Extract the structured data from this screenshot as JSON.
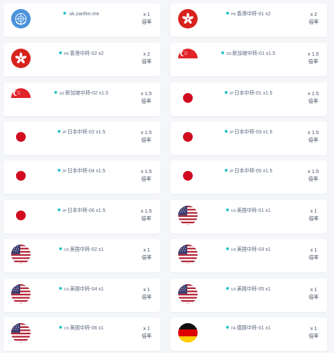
{
  "unit_label": "倍率",
  "nodes": [
    {
      "flag": "un",
      "prefix": "",
      "name": "uk.sanfen.me",
      "multiplier": "x 1"
    },
    {
      "flag": "hk",
      "prefix": "HK",
      "name": "香港中转-01 x2",
      "multiplier": "x 2"
    },
    {
      "flag": "hk",
      "prefix": "HK",
      "name": "香港中转-02 x2",
      "multiplier": "x 2"
    },
    {
      "flag": "sg",
      "prefix": "SG",
      "name": "新加坡中转-01 x1.5",
      "multiplier": "x 1.5"
    },
    {
      "flag": "sg",
      "prefix": "SG",
      "name": "新加坡中转-02 x1.5",
      "multiplier": "x 1.5"
    },
    {
      "flag": "jp",
      "prefix": "JP",
      "name": "日本中转-01 x1.5",
      "multiplier": "x 1.5"
    },
    {
      "flag": "jp",
      "prefix": "JP",
      "name": "日本中转-02 x1.5",
      "multiplier": "x 1.5"
    },
    {
      "flag": "jp",
      "prefix": "JP",
      "name": "日本中转-03 x1.5",
      "multiplier": "x 1.5"
    },
    {
      "flag": "jp",
      "prefix": "JP",
      "name": "日本中转-04 x1.5",
      "multiplier": "x 1.5"
    },
    {
      "flag": "jp",
      "prefix": "JP",
      "name": "日本中转-05 x1.5",
      "multiplier": "x 1.5"
    },
    {
      "flag": "jp",
      "prefix": "JP",
      "name": "日本中转-06 x1.5",
      "multiplier": "x 1.5"
    },
    {
      "flag": "us",
      "prefix": "US",
      "name": "美国中转-01 x1",
      "multiplier": "x 1"
    },
    {
      "flag": "us",
      "prefix": "US",
      "name": "美国中转-02 x1",
      "multiplier": "x 1"
    },
    {
      "flag": "us",
      "prefix": "US",
      "name": "美国中转-03 x1",
      "multiplier": "x 1"
    },
    {
      "flag": "us",
      "prefix": "US",
      "name": "美国中转-04 x1",
      "multiplier": "x 1"
    },
    {
      "flag": "us",
      "prefix": "US",
      "name": "美国中转-05 x1",
      "multiplier": "x 1"
    },
    {
      "flag": "us",
      "prefix": "US",
      "name": "美国中转-06 x1",
      "multiplier": "x 1"
    },
    {
      "flag": "de",
      "prefix": "DE",
      "name": "德国中转-01 x1",
      "multiplier": "x 1"
    }
  ],
  "colors": {
    "status_dot": "#21c3c9",
    "card": "#ffffff",
    "background": "#f4f6f9"
  }
}
